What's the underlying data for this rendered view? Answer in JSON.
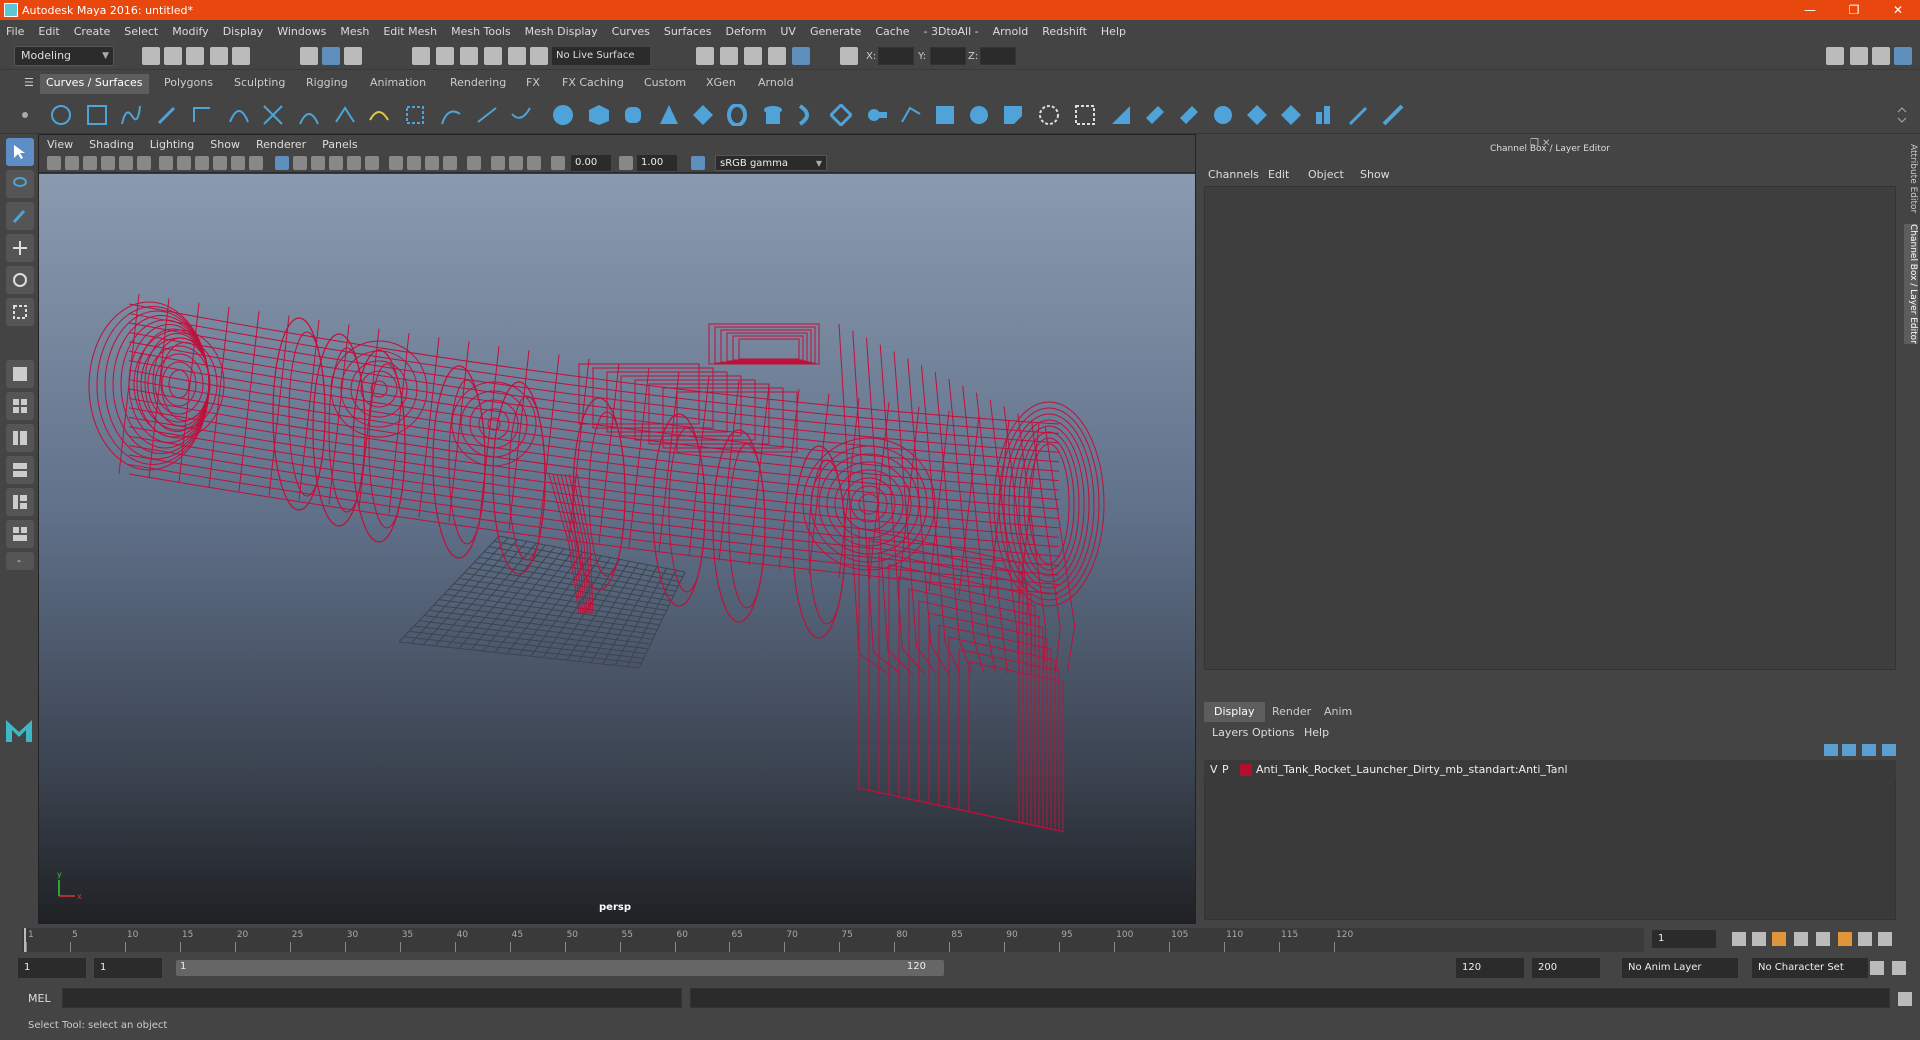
{
  "window": {
    "title": "Autodesk Maya 2016: untitled*"
  },
  "menubar": [
    "File",
    "Edit",
    "Create",
    "Select",
    "Modify",
    "Display",
    "Windows",
    "Mesh",
    "Edit Mesh",
    "Mesh Tools",
    "Mesh Display",
    "Curves",
    "Surfaces",
    "Deform",
    "UV",
    "Generate",
    "Cache",
    "- 3DtoAll -",
    "Arnold",
    "Redshift",
    "Help"
  ],
  "status_line": {
    "mode": "Modeling",
    "live_surface": "No Live Surface",
    "x_label": "X:",
    "y_label": "Y:",
    "z_label": "Z:"
  },
  "shelf": {
    "tabs": [
      "Curves / Surfaces",
      "Polygons",
      "Sculpting",
      "Rigging",
      "Animation",
      "Rendering",
      "FX",
      "FX Caching",
      "Custom",
      "XGen",
      "Arnold"
    ],
    "active_tab": "Curves / Surfaces"
  },
  "viewport": {
    "menu": [
      "View",
      "Shading",
      "Lighting",
      "Show",
      "Renderer",
      "Panels"
    ],
    "exposure": "0.00",
    "gamma": "1.00",
    "color_space": "sRGB gamma",
    "camera": "persp",
    "wire_color": "#c0103a"
  },
  "channel_box": {
    "title": "Channel Box / Layer Editor",
    "menu": [
      "Channels",
      "Edit",
      "Object",
      "Show"
    ]
  },
  "layer_editor": {
    "tabs": [
      "Display",
      "Render",
      "Anim"
    ],
    "active_tab": "Display",
    "menu": [
      "Layers",
      "Options",
      "Help"
    ],
    "layers": [
      {
        "v": "V",
        "p": "P",
        "color": "#b0102e",
        "name": "Anti_Tank_Rocket_Launcher_Dirty_mb_standart:Anti_Tanl"
      }
    ]
  },
  "side_tabs": [
    "Attribute Editor",
    "Channel Box / Layer Editor"
  ],
  "time_slider": {
    "ticks": [
      "1",
      "5",
      "10",
      "15",
      "20",
      "25",
      "30",
      "35",
      "40",
      "45",
      "50",
      "55",
      "60",
      "65",
      "70",
      "75",
      "80",
      "85",
      "90",
      "95",
      "100",
      "105",
      "110",
      "115",
      "120"
    ],
    "current_frame": "1"
  },
  "range_slider": {
    "start": "1",
    "start_inner": "1",
    "range_start_label": "1",
    "range_end_label": "120",
    "end_inner": "120",
    "end": "200",
    "anim_layer": "No Anim Layer",
    "character_set": "No Character Set"
  },
  "command_line": {
    "label": "MEL"
  },
  "help_line": {
    "text": "Select Tool: select an object"
  }
}
